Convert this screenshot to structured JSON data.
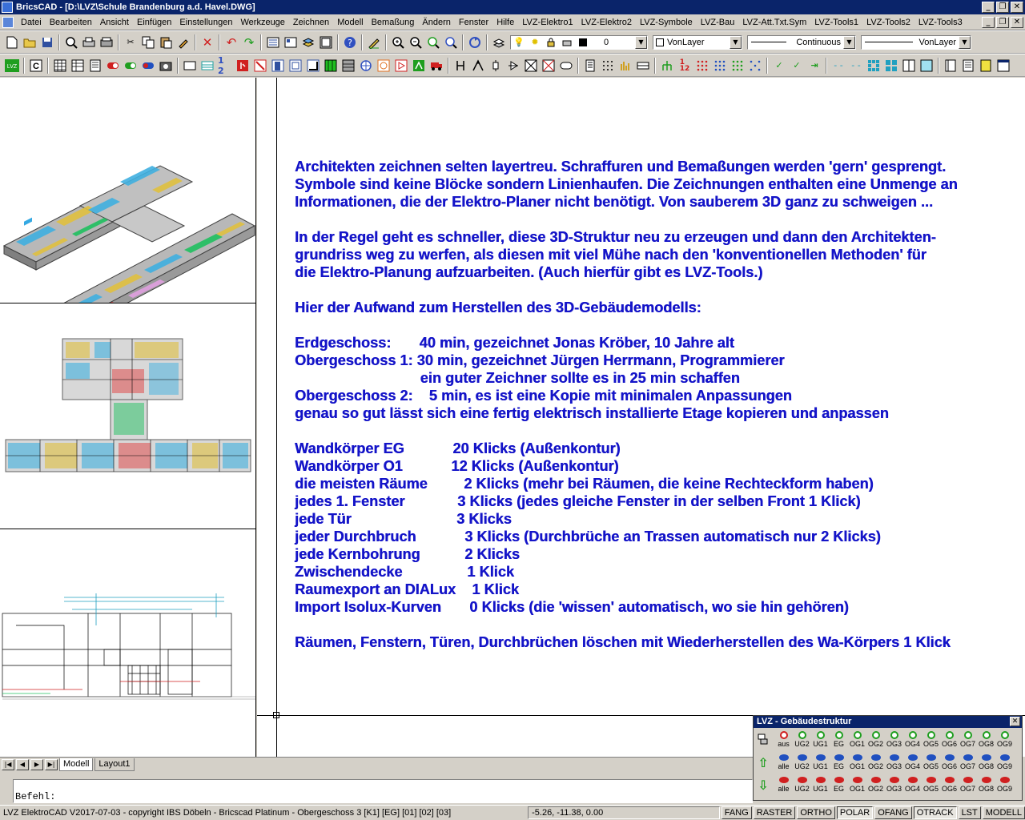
{
  "window": {
    "title": "BricsCAD - [D:\\LVZ\\Schule Brandenburg a.d. Havel.DWG]",
    "controls": [
      "_",
      "❐",
      "✕"
    ]
  },
  "menubar": {
    "items": [
      "Datei",
      "Bearbeiten",
      "Ansicht",
      "Einfügen",
      "Einstellungen",
      "Werkzeuge",
      "Zeichnen",
      "Modell",
      "Bemaßung",
      "Ändern",
      "Fenster",
      "Hilfe",
      "LVZ-Elektro1",
      "LVZ-Elektro2",
      "LVZ-Symbole",
      "LVZ-Bau",
      "LVZ-Att.Txt.Sym",
      "LVZ-Tools1",
      "LVZ-Tools2",
      "LVZ-Tools3"
    ],
    "doc_controls": [
      "_",
      "❐",
      "✕"
    ]
  },
  "toolbar1": {
    "layer_value": "0",
    "color_value": "VonLayer",
    "linetype_value": "Continuous",
    "lineweight_value": "VonLayer"
  },
  "drawing_text": {
    "lines": [
      "Architekten zeichnen selten layertreu. Schraffuren und Bemaßungen werden 'gern' gesprengt.",
      "Symbole sind keine Blöcke sondern Linienhaufen. Die Zeichnungen enthalten eine Unmenge an",
      "Informationen, die der Elektro-Planer nicht benötigt. Von sauberem 3D ganz zu schweigen ...",
      "",
      "In der Regel geht es schneller, diese 3D-Struktur neu zu erzeugen und dann den Architekten-",
      "grundriss weg zu werfen, als diesen mit viel Mühe nach den 'konventionellen Methoden' für",
      "die Elektro-Planung aufzuarbeiten. (Auch hierfür gibt es LVZ-Tools.)",
      "",
      "Hier der Aufwand zum Herstellen des 3D-Gebäudemodells:",
      "",
      "Erdgeschoss:       40 min, gezeichnet Jonas Kröber, 10 Jahre alt",
      "Obergeschoss 1: 30 min, gezeichnet Jürgen Herrmann, Programmierer",
      "                               ein guter Zeichner sollte es in 25 min schaffen",
      "Obergeschoss 2:    5 min, es ist eine Kopie mit minimalen Anpassungen",
      "genau so gut lässt sich eine fertig elektrisch installierte Etage kopieren und anpassen",
      "",
      "Wandkörper EG            20 Klicks (Außenkontur)",
      "Wandkörper O1            12 Klicks (Außenkontur)",
      "die meisten Räume         2 Klicks (mehr bei Räumen, die keine Rechteckform haben)",
      "jedes 1. Fenster             3 Klicks (jedes gleiche Fenster in der selben Front 1 Klick)",
      "jede Tür                          3 Klicks",
      "jeder Durchbruch            3 Klicks (Durchbrüche an Trassen automatisch nur 2 Klicks)",
      "jede Kernbohrung           2 Klicks",
      "Zwischendecke                1 Klick",
      "Raumexport an DIALux    1 Klick",
      "Import Isolux-Kurven       0 Klicks (die 'wissen' automatisch, wo sie hin gehören)",
      "",
      "Räumen, Fenstern, Türen, Durchbrüchen löschen mit Wiederherstellen des Wa-Körpers 1 Klick"
    ]
  },
  "tabs": {
    "nav": [
      "|◀",
      "◀",
      "▶",
      "▶|"
    ],
    "items": [
      "Modell",
      "Layout1"
    ]
  },
  "command": {
    "prompt": "Befehl:"
  },
  "statusbar": {
    "info": "LVZ ElektroCAD V2017-07-03 - copyright IBS Döbeln - Bricscad Platinum   - Obergeschoss 3   [K1]  [EG]  [01]  [02]  [03]",
    "coords": "-5.26,  -11.38, 0.00",
    "buttons": [
      "FANG",
      "RASTER",
      "ORTHO",
      "POLAR",
      "OFANG",
      "OTRACK",
      "LST",
      "MODELL"
    ],
    "active": [
      "POLAR",
      "OTRACK"
    ]
  },
  "panel": {
    "title": "LVZ - Gebäudestruktur",
    "close": "✕",
    "row1_first": "aus",
    "row2_first": "alle",
    "row3_first": "alle",
    "floors": [
      "UG2",
      "UG1",
      "EG",
      "OG1",
      "OG2",
      "OG3",
      "OG4",
      "OG5",
      "OG6",
      "OG7",
      "OG8",
      "OG9"
    ],
    "colors": {
      "green": "#1f9e1f",
      "red": "#d02020",
      "blue": "#2050c0",
      "text": "#1414c8"
    }
  }
}
